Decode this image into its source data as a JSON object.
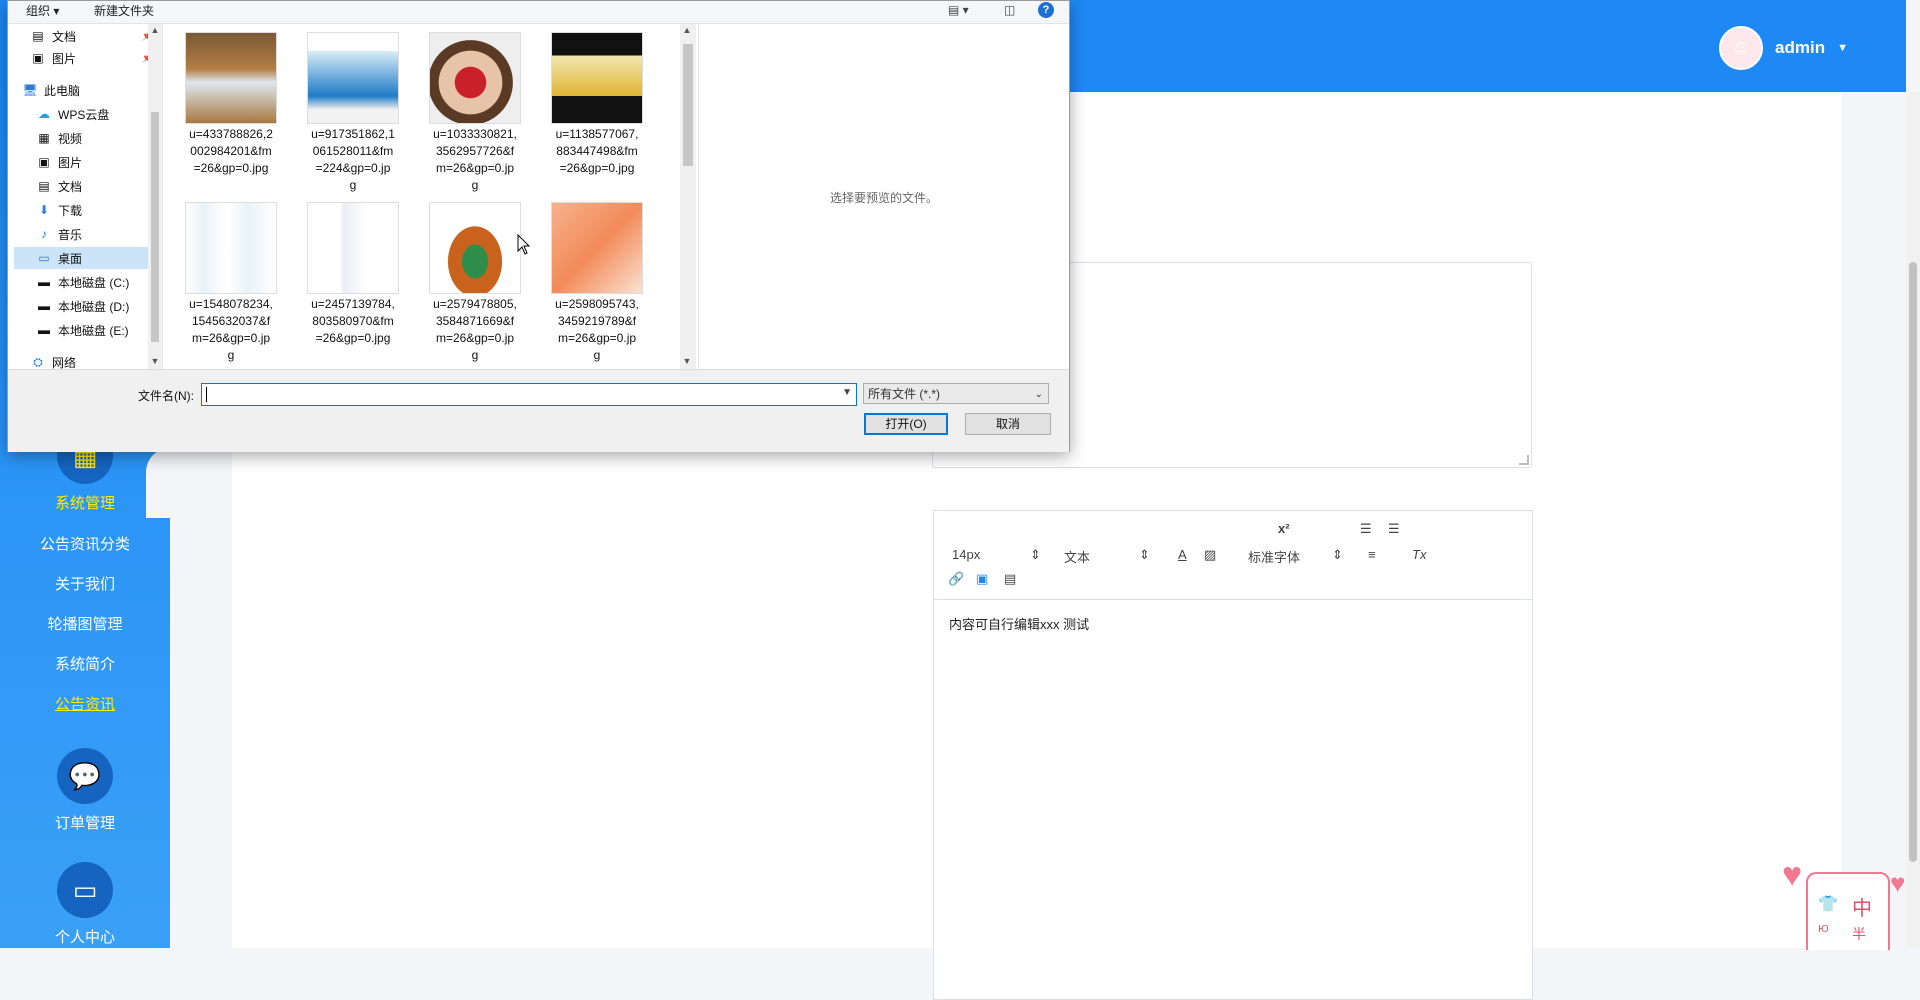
{
  "header": {
    "username": "admin",
    "caret": "▼"
  },
  "sidebar": {
    "items": [
      {
        "label": "系统管理"
      },
      {
        "label": "公告资讯分类"
      },
      {
        "label": "关于我们"
      },
      {
        "label": "轮播图管理"
      },
      {
        "label": "系统简介"
      },
      {
        "label": "公告资讯"
      },
      {
        "label": "订单管理"
      },
      {
        "label": "个人中心"
      }
    ]
  },
  "editor": {
    "font_size": "14px",
    "format": "文本",
    "font_family": "标准字体",
    "content": "内容可自行编辑xxx 测试"
  },
  "mascot": {
    "text1": "中",
    "text2": "半",
    "text3": "Ю"
  },
  "dialog": {
    "toolbar": {
      "organize": "组织 ▾",
      "new_folder": "新建文件夹"
    },
    "nav": [
      {
        "label": "文档",
        "icon": "document-icon"
      },
      {
        "label": "图片",
        "icon": "pictures-icon"
      },
      {
        "label": "此电脑",
        "icon": "computer-icon"
      },
      {
        "label": "WPS云盘",
        "icon": "cloud-icon"
      },
      {
        "label": "视频",
        "icon": "video-icon"
      },
      {
        "label": "图片",
        "icon": "pictures-icon"
      },
      {
        "label": "文档",
        "icon": "document-icon"
      },
      {
        "label": "下载",
        "icon": "download-icon"
      },
      {
        "label": "音乐",
        "icon": "music-icon"
      },
      {
        "label": "桌面",
        "icon": "desktop-icon"
      },
      {
        "label": "本地磁盘 (C:)",
        "icon": "drive-icon"
      },
      {
        "label": "本地磁盘 (D:)",
        "icon": "drive-icon"
      },
      {
        "label": "本地磁盘 (E:)",
        "icon": "drive-icon"
      },
      {
        "label": "网络",
        "icon": "network-icon"
      }
    ],
    "files": [
      {
        "name": "u=433788826,2002984201&fm=26&gp=0.jpg",
        "display": "u=433788826,2\n002984201&fm\n=26&gp=0.jpg"
      },
      {
        "name": "u=917351862,1061528011&fm=224&gp=0.jpg",
        "display": "u=917351862,1\n061528011&fm\n=224&gp=0.jp\ng"
      },
      {
        "name": "u=1033330821,3562957726&fm=26&gp=0.jpg",
        "display": "u=1033330821,\n3562957726&f\nm=26&gp=0.jp\ng"
      },
      {
        "name": "u=1138577067,883447498&fm=26&gp=0.jpg",
        "display": "u=1138577067,\n883447498&fm\n=26&gp=0.jpg"
      },
      {
        "name": "u=1548078234,1545632037&fm=26&gp=0.jpg",
        "display": "u=1548078234,\n1545632037&f\nm=26&gp=0.jp\ng"
      },
      {
        "name": "u=2457139784,803580970&fm=26&gp=0.jpg",
        "display": "u=2457139784,\n803580970&fm\n=26&gp=0.jpg"
      },
      {
        "name": "u=2579478805,3584871669&fm=26&gp=0.jpg",
        "display": "u=2579478805,\n3584871669&f\nm=26&gp=0.jp\ng"
      },
      {
        "name": "u=2598095743,3459219789&fm=26&gp=0.jpg",
        "display": "u=2598095743,\n3459219789&f\nm=26&gp=0.jp\ng"
      }
    ],
    "preview_text": "选择要预览的文件。",
    "filename_label": "文件名(N):",
    "filename_value": "",
    "filetype": "所有文件 (*.*)",
    "open_label": "打开(O)",
    "cancel_label": "取消"
  }
}
